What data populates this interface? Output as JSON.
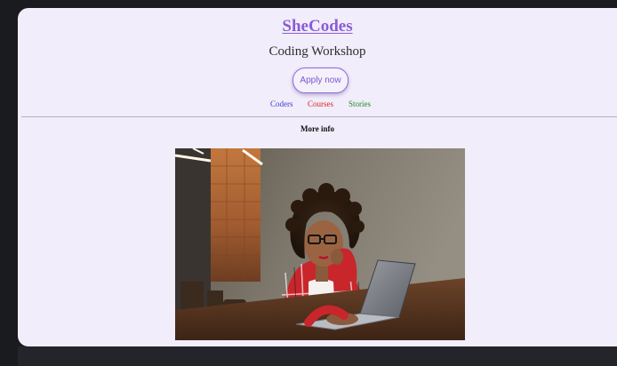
{
  "header": {
    "brand": "SheCodes",
    "subtitle": "Coding Workshop",
    "apply_label": "Apply now"
  },
  "nav": {
    "items": [
      {
        "label": "Coders",
        "color": "#3b3bd6"
      },
      {
        "label": "Courses",
        "color": "#e22222"
      },
      {
        "label": "Stories",
        "color": "#238a23"
      }
    ]
  },
  "main": {
    "more_info_label": "More info",
    "image_alt": "Woman with curly hair and glasses working on a laptop"
  },
  "colors": {
    "page_background": "#f1edfb",
    "accent": "#8a5cd6",
    "outer_background": "#1a1b1f"
  }
}
